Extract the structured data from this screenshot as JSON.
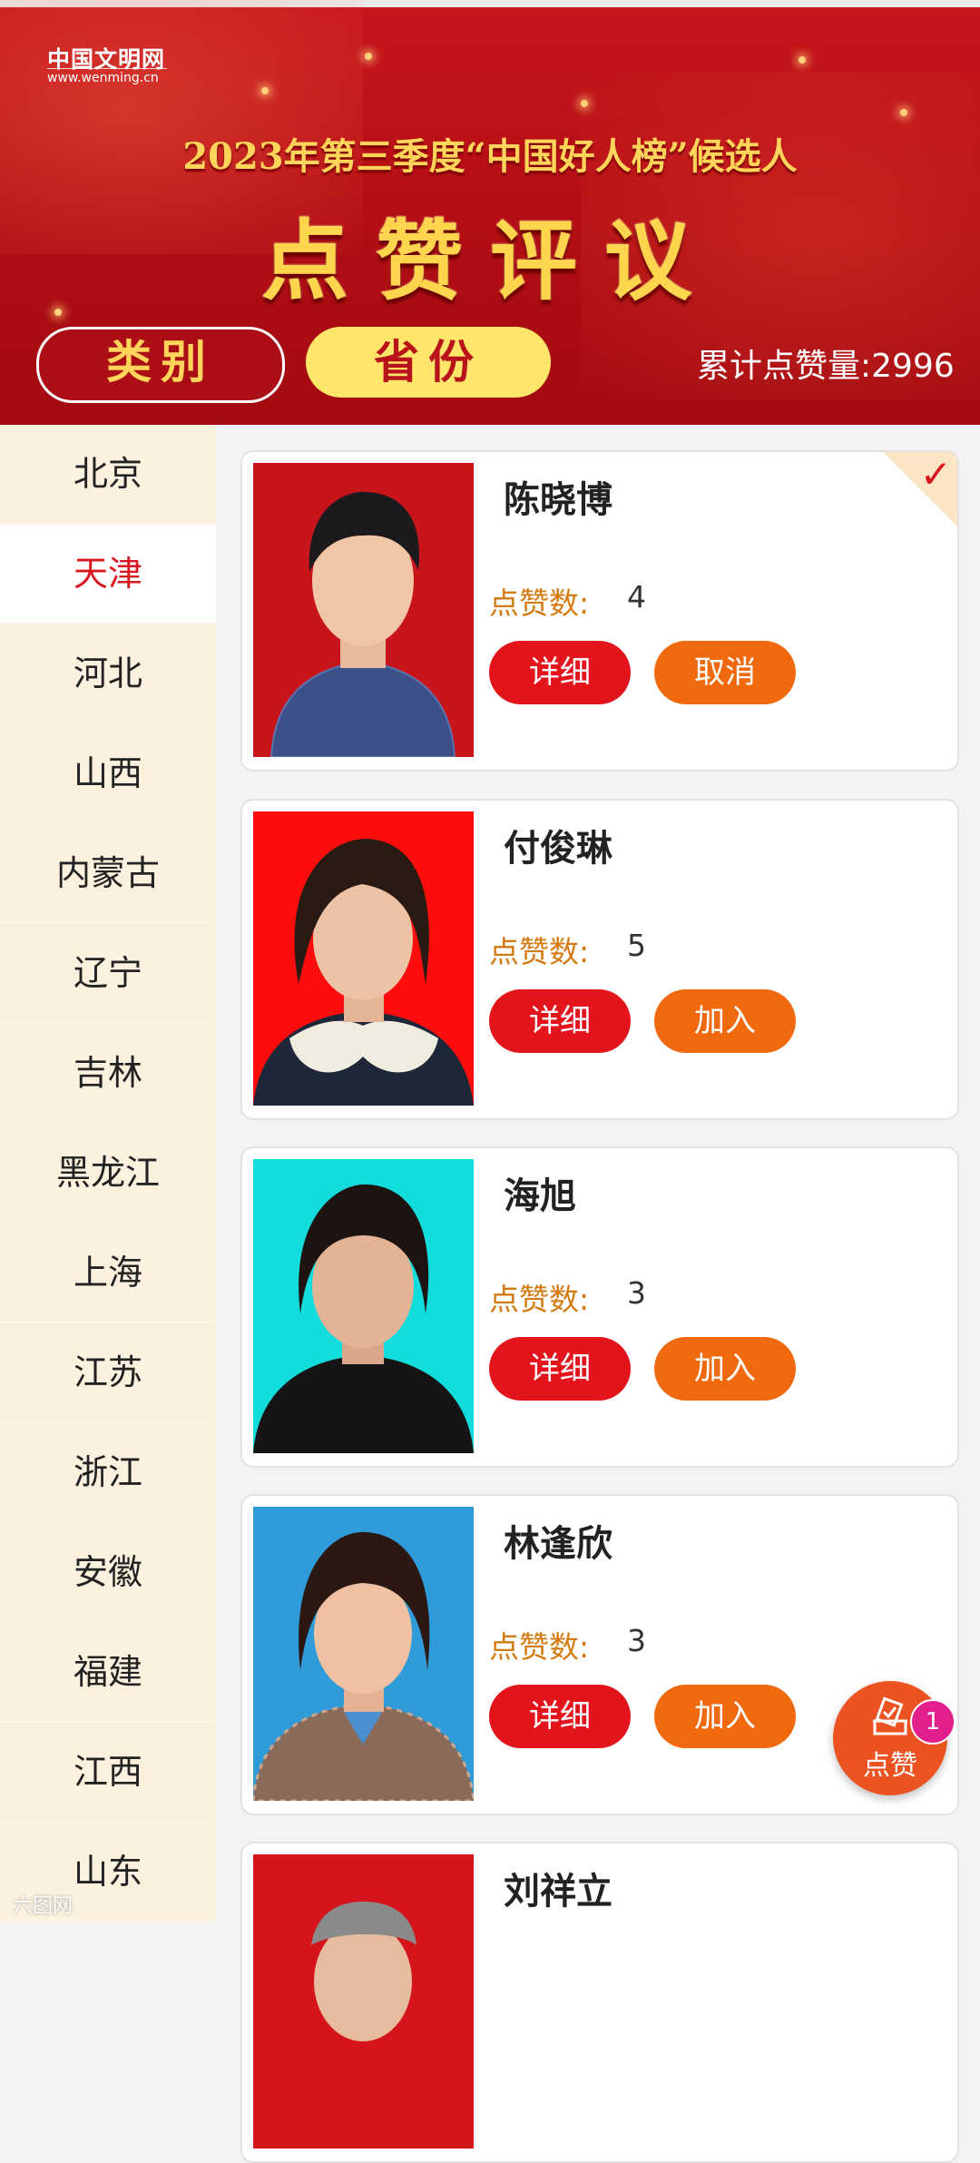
{
  "header": {
    "logo_cn": "中国文明网",
    "logo_en": "www.wenming.cn",
    "subtitle": "2023年第三季度“中国好人榜”候选人",
    "title": "点赞评议",
    "tab_category": "类别",
    "tab_province": "省份",
    "total_likes": "累计点赞量:2996"
  },
  "sidebar": {
    "items": [
      "北京",
      "天津",
      "河北",
      "山西",
      "内蒙古",
      "辽宁",
      "吉林",
      "黑龙江",
      "上海",
      "江苏",
      "浙江",
      "安徽",
      "福建",
      "江西",
      "山东"
    ],
    "active": "天津"
  },
  "candidates": [
    {
      "name": "陈晓博",
      "votes_label": "点赞数:",
      "votes": "4",
      "detail": "详细",
      "action": "取消",
      "selected": true
    },
    {
      "name": "付俊琳",
      "votes_label": "点赞数:",
      "votes": "5",
      "detail": "详细",
      "action": "加入",
      "selected": false
    },
    {
      "name": "海旭",
      "votes_label": "点赞数:",
      "votes": "3",
      "detail": "详细",
      "action": "加入",
      "selected": false
    },
    {
      "name": "林逢欣",
      "votes_label": "点赞数:",
      "votes": "3",
      "detail": "详细",
      "action": "加入",
      "selected": false
    },
    {
      "name": "刘祥立",
      "votes_label": "",
      "votes": "",
      "detail": "",
      "action": "",
      "selected": false
    }
  ],
  "fab": {
    "label": "点赞",
    "badge": "1",
    "icon": "vote-box-icon"
  },
  "watermark": "六图网"
}
